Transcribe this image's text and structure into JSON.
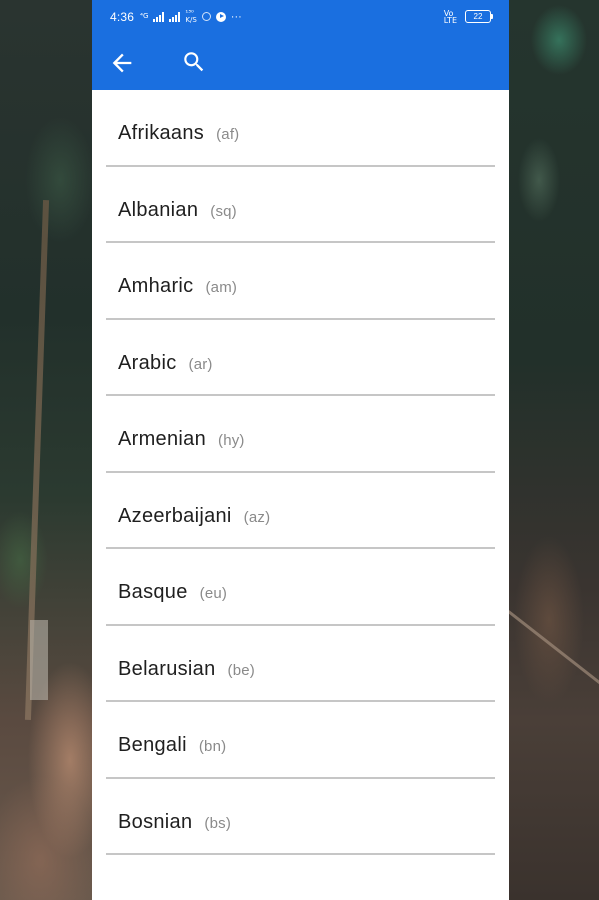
{
  "status_bar": {
    "time": "4:36",
    "indicators": [
      "signal-icon",
      "signal-icon",
      "data-icon",
      "sync-icon",
      "media-play-icon",
      "more-icon"
    ],
    "more": "···",
    "right_indicators": [
      "volte-icon"
    ],
    "battery_level": "22"
  },
  "app_bar": {
    "color": "#1a6fe0",
    "back_icon": "arrow-left-icon",
    "search_icon": "search-icon"
  },
  "languages": [
    {
      "name": "Afrikaans",
      "code": "(af)"
    },
    {
      "name": "Albanian",
      "code": "(sq)"
    },
    {
      "name": "Amharic",
      "code": "(am)"
    },
    {
      "name": "Arabic",
      "code": "(ar)"
    },
    {
      "name": "Armenian",
      "code": "(hy)"
    },
    {
      "name": "Azeerbaijani",
      "code": "(az)"
    },
    {
      "name": "Basque",
      "code": "(eu)"
    },
    {
      "name": "Belarusian",
      "code": "(be)"
    },
    {
      "name": "Bengali",
      "code": "(bn)"
    },
    {
      "name": "Bosnian",
      "code": "(bs)"
    }
  ]
}
